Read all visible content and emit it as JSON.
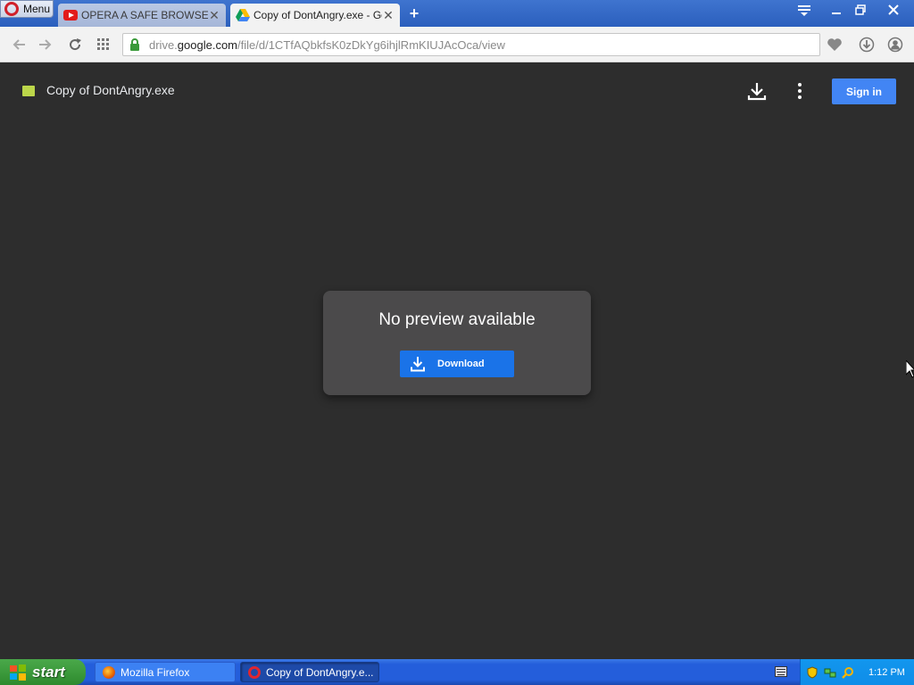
{
  "browser": {
    "menu_label": "Menu",
    "tabs": [
      {
        "title": "OPERA A SAFE BROWSER FOR",
        "icon": "youtube-icon",
        "active": false
      },
      {
        "title": "Copy of DontAngry.exe - Goo",
        "icon": "google-drive-icon",
        "active": true
      }
    ],
    "url": {
      "prefix": "drive.",
      "domain": "google.com",
      "path": "/file/d/1CTfAQbkfsK0zDkYg6ihjlRmKIUJAcOca/view"
    },
    "accent": "#3f74cf"
  },
  "viewer": {
    "file_title": "Copy of DontAngry.exe",
    "sign_in_label": "Sign in",
    "no_preview_text": "No preview available",
    "download_label": "Download",
    "sign_in_color": "#4285f4",
    "download_color": "#1a73e8",
    "background": "#2d2d2d"
  },
  "taskbar": {
    "start_label": "start",
    "tasks": [
      {
        "label": "Mozilla Firefox",
        "icon": "firefox-icon"
      },
      {
        "label": "Copy of DontAngry.e...",
        "icon": "opera-icon"
      }
    ],
    "clock": "1:12 PM"
  }
}
